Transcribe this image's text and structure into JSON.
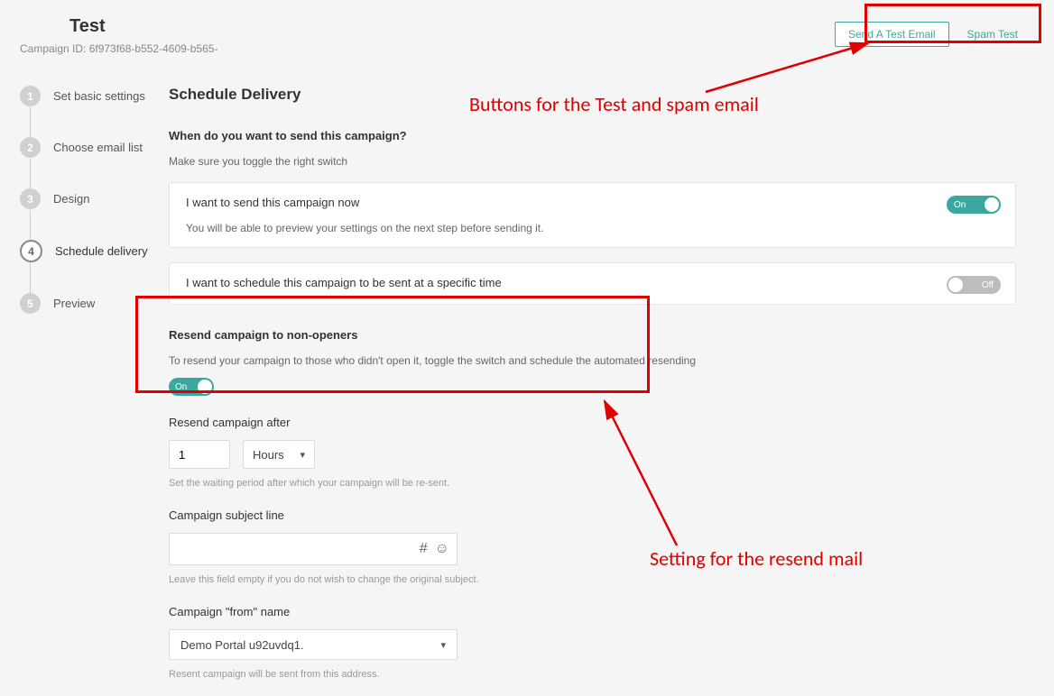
{
  "header": {
    "title": "Test",
    "campaign_id_label": "Campaign ID: 6f973f68-b552-4609-b565-",
    "send_test_email": "Send A Test Email",
    "spam_test": "Spam Test"
  },
  "stepper": {
    "items": [
      {
        "num": "1",
        "label": "Set basic settings"
      },
      {
        "num": "2",
        "label": "Choose email list"
      },
      {
        "num": "3",
        "label": "Design"
      },
      {
        "num": "4",
        "label": "Schedule delivery"
      },
      {
        "num": "5",
        "label": "Preview"
      }
    ]
  },
  "main": {
    "heading": "Schedule Delivery",
    "question": "When do you want to send this campaign?",
    "question_sub": "Make sure you toggle the right switch",
    "card_now": {
      "title": "I want to send this campaign now",
      "sub": "You will be able to preview your settings on the next step before sending it.",
      "toggle_label": "On"
    },
    "card_schedule": {
      "title": "I want to schedule this campaign to be sent at a specific time",
      "toggle_label": "Off"
    },
    "resend": {
      "title": "Resend campaign to non-openers",
      "sub": "To resend your campaign to those who didn't open it, toggle the switch and schedule the automated resending",
      "toggle_label": "On"
    },
    "after": {
      "label": "Resend campaign after",
      "value": "1",
      "unit": "Hours",
      "helper": "Set the waiting period after which your campaign will be re-sent."
    },
    "subject": {
      "label": "Campaign subject line",
      "value": "",
      "helper": "Leave this field empty if you do not wish to change the original subject."
    },
    "from": {
      "label": "Campaign \"from\" name",
      "value": "Demo Portal u92uvdq1.",
      "helper": "Resent campaign will be sent from this address."
    }
  },
  "annotations": {
    "top": "Buttons for the Test and spam email",
    "bottom": "Setting for the resend mail"
  }
}
